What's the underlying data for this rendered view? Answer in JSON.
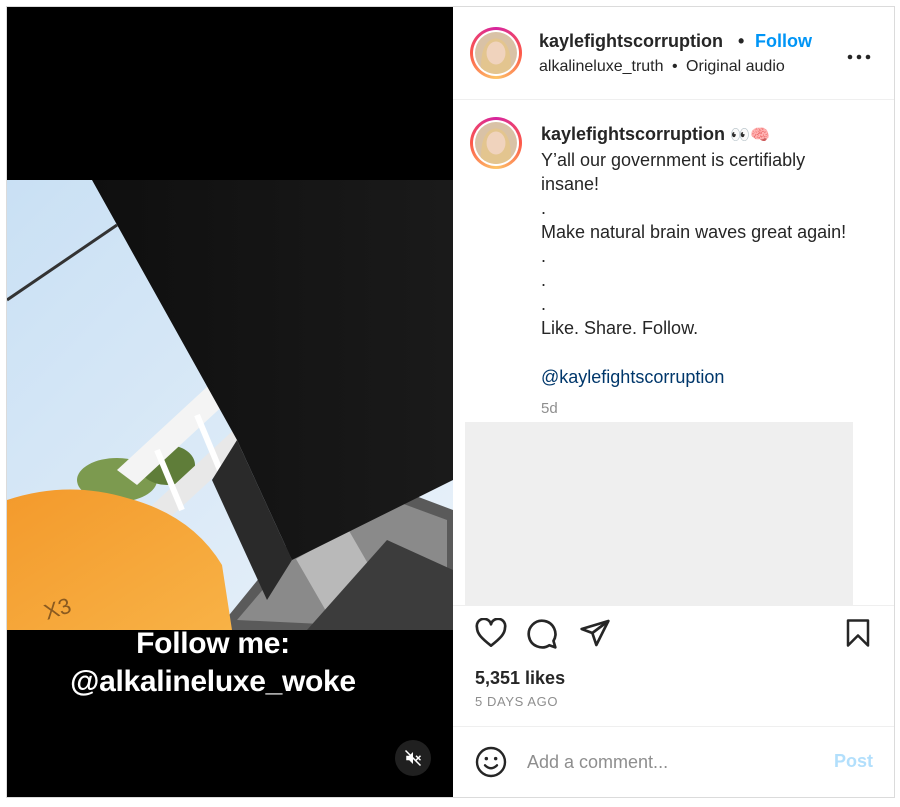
{
  "video": {
    "overlay_line1": "Follow me:",
    "overlay_line2": "@alkalineluxe_woke",
    "mute_icon": "speaker-muted-icon"
  },
  "header": {
    "username": "kaylefightscorruption",
    "separator": "•",
    "follow_label": "Follow",
    "audio_user": "alkalineluxe_truth",
    "audio_separator": "•",
    "audio_label": "Original audio",
    "more_icon": "more-options-icon"
  },
  "caption": {
    "username": "kaylefightscorruption",
    "emojis": "👀🧠",
    "text": "Y’all our government is certifiably insane!\n.\nMake natural brain waves great again!\n.\n.\n.\nLike. Share. Follow.",
    "mention": "@kaylefightscorruption",
    "time": "5d"
  },
  "actions": {
    "like_icon": "heart-icon",
    "comment_icon": "comment-icon",
    "share_icon": "share-icon",
    "save_icon": "bookmark-icon",
    "likes": "5,351 likes",
    "posted": "5 DAYS AGO"
  },
  "comment_box": {
    "placeholder": "Add a comment...",
    "post_label": "Post",
    "emoji_icon": "smiley-icon"
  },
  "colors": {
    "accent": "#0095f6",
    "mention": "#00376b",
    "post_disabled": "#b2dffc"
  }
}
